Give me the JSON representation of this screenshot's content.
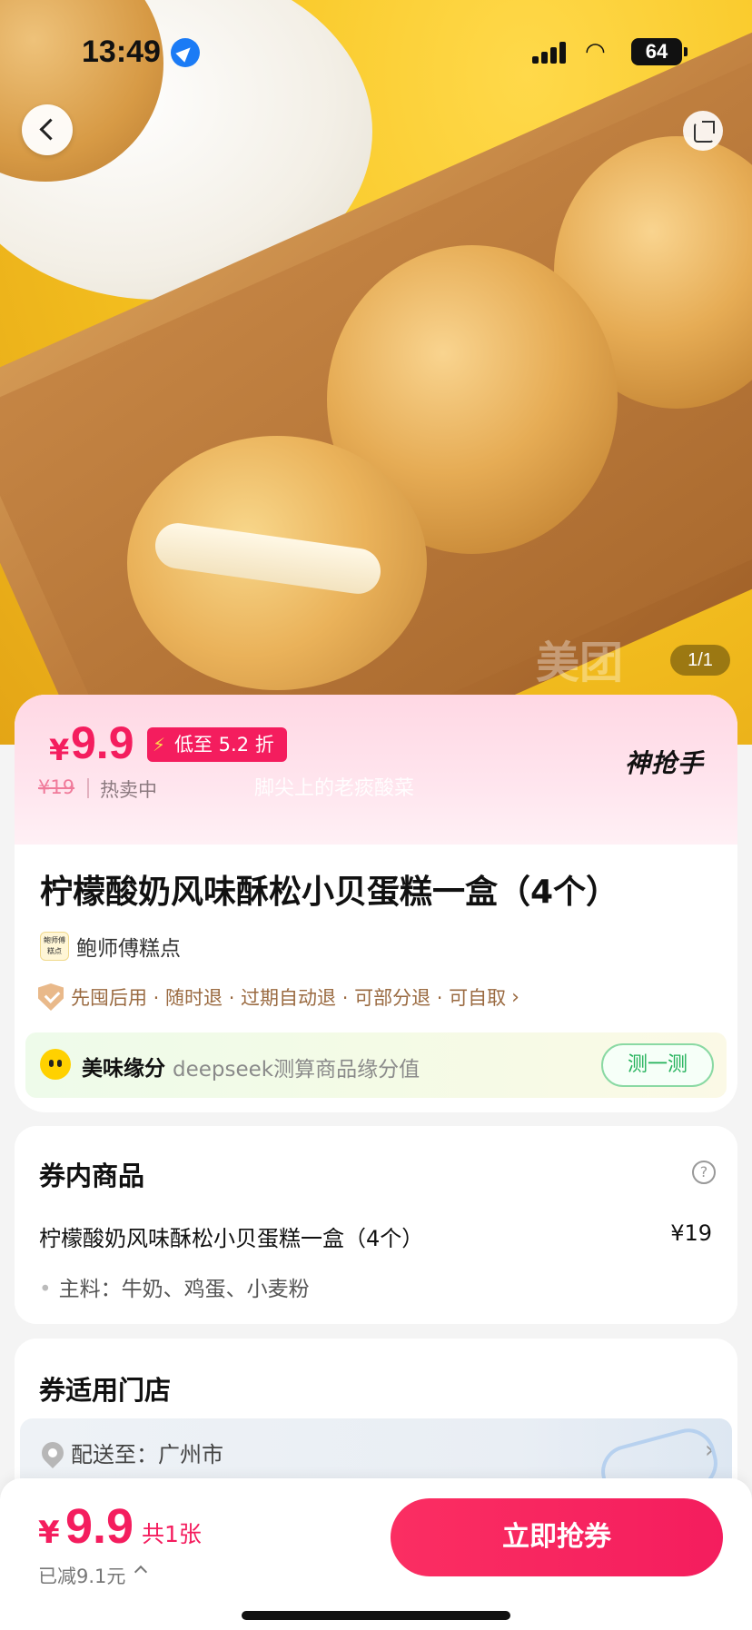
{
  "status_bar": {
    "time": "13:49",
    "battery": "64"
  },
  "hero": {
    "pager": "1/1",
    "watermark": "美团"
  },
  "price_banner": {
    "currency": "¥",
    "price": "9.9",
    "discount_tag": "低至 5.2 折",
    "original_price": "¥19",
    "status": "热卖中",
    "overlay_text": "脚尖上的老痰酸菜",
    "brand_logo": "神抢手"
  },
  "product": {
    "title": "柠檬酸奶风味酥松小贝蛋糕一盒（4个）",
    "shop_name": "鲍师傅糕点",
    "shop_logo_text": "鲍师傅糕点",
    "guarantees": "先囤后用 · 随时退 · 过期自动退 · 可部分退 · 可自取"
  },
  "fate": {
    "title": "美味缘分",
    "description": "deepseek测算商品缘分值",
    "button": "测一测"
  },
  "coupon_items": {
    "title": "券内商品",
    "help": "?",
    "item_name": "柠檬酸奶风味酥松小贝蛋糕一盒（4个）",
    "item_price": "¥19",
    "ingredients": "主料：牛奶、鸡蛋、小麦粉"
  },
  "stores": {
    "title": "券适用门店",
    "deliver_to": "配送至：广州市"
  },
  "bottom_bar": {
    "currency": "¥",
    "price": "9.9",
    "count": "共1张",
    "saved": "已减9.1元",
    "buy_button": "立即抢券"
  },
  "colors": {
    "accent": "#f41d5e",
    "hero_bg": "#f7c521",
    "fate_button": "#23b25a"
  }
}
